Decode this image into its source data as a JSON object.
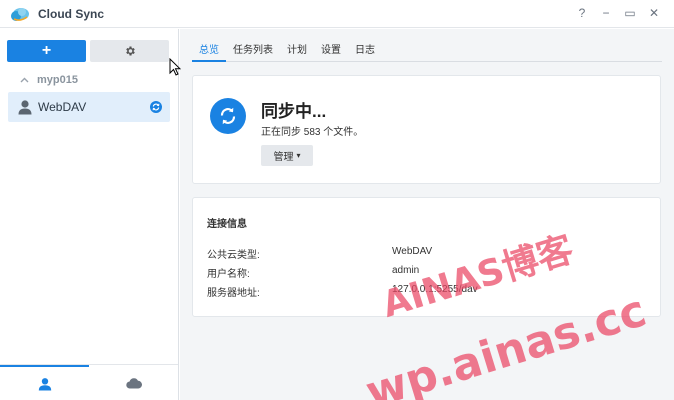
{
  "window": {
    "title": "Cloud Sync",
    "help_glyph": "?",
    "minimize_glyph": "−",
    "maximize_glyph": "▭",
    "close_glyph": "✕"
  },
  "sidebar": {
    "add_button_glyph": "+",
    "group_name": "myp015",
    "connections": [
      {
        "label": "WebDAV",
        "icon": "user-icon",
        "status_icon": "sync-icon"
      }
    ],
    "bottom_tabs": [
      {
        "icon": "user-icon",
        "active": true
      },
      {
        "icon": "cloud-icon",
        "active": false
      }
    ]
  },
  "tabs": [
    {
      "label": "总览",
      "active": true
    },
    {
      "label": "任务列表",
      "active": false
    },
    {
      "label": "计划",
      "active": false
    },
    {
      "label": "设置",
      "active": false
    },
    {
      "label": "日志",
      "active": false
    }
  ],
  "status": {
    "title": "同步中...",
    "subtitle": "正在同步 583 个文件。",
    "manage_label": "管理",
    "manage_caret": "▾"
  },
  "connection_info": {
    "title": "连接信息",
    "rows": [
      {
        "key": "公共云类型:",
        "value": "WebDAV"
      },
      {
        "key": "用户名称:",
        "value": "admin"
      },
      {
        "key": "服务器地址:",
        "value": "127.0.0.1:5255/dav"
      }
    ]
  },
  "watermark": {
    "line1": "AINAS博客",
    "line2": "wp.ainas.cc"
  },
  "colors": {
    "accent": "#1a82e2",
    "selected_bg": "#e1eefb",
    "watermark": "#ea4664"
  }
}
